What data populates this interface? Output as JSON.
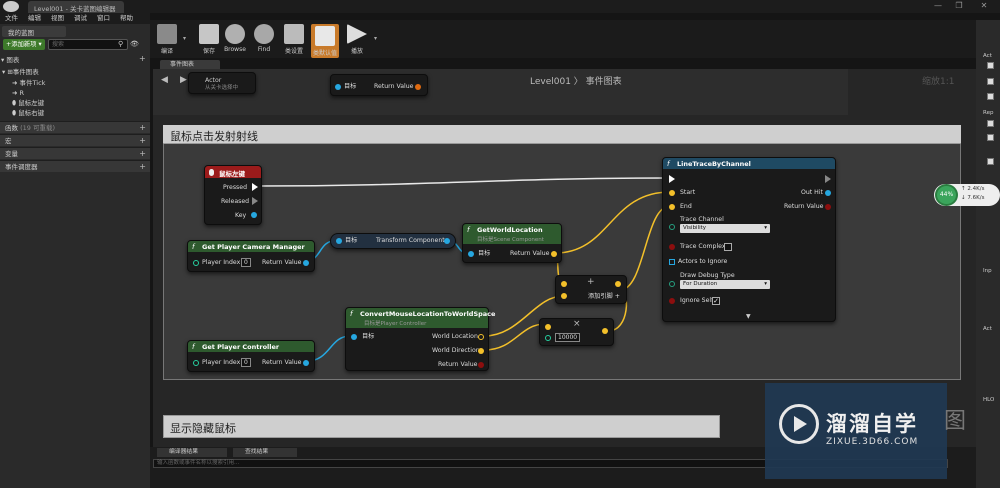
{
  "window": {
    "tab_title": "Level001 - 关卡蓝图编辑器",
    "minimize": "—",
    "restore": "❐",
    "close": "✕"
  },
  "menu": [
    "文件",
    "编辑",
    "视图",
    "调试",
    "窗口",
    "帮助"
  ],
  "left_panel": {
    "tab": "我的蓝图",
    "add_new": "+添加新项 ▾",
    "search_placeholder": "搜索",
    "graphs_header": "图表",
    "event_graph": "事件图表",
    "events": [
      "事件Tick",
      "R",
      "鼠标左键",
      "鼠标右键"
    ],
    "functions_header": "函数",
    "functions_note": "(19 可重载)",
    "macros_header": "宏",
    "variables_header": "变量",
    "dispatchers_header": "事件调度器"
  },
  "toolbar": {
    "buttons": [
      "编译",
      "保存",
      "Browse",
      "Find",
      "类设置",
      "类默认值",
      "播放"
    ]
  },
  "graph": {
    "tab": "事件图表",
    "breadcrumb": "Level001 〉 事件图表",
    "zoom": "缩放1:1",
    "top_node_actor": "Actor",
    "top_node_actor_sub": "从关卡选择中",
    "top_node_target": "目标",
    "top_node_return": "Return Value"
  },
  "comments": {
    "c1": "鼠标点击发射射线",
    "c2": "显示隐藏鼠标"
  },
  "nodes": {
    "mouse_left": {
      "title": "鼠标左键",
      "pins": [
        "Pressed",
        "Released",
        "Key"
      ]
    },
    "camera_mgr": {
      "title": "Get Player Camera Manager",
      "index_label": "Player Index",
      "index_value": "0",
      "return": "Return Value"
    },
    "transform": {
      "target": "目标",
      "output": "Transform Component"
    },
    "world_loc": {
      "title": "GetWorldLocation",
      "sub": "目标是Scene Component",
      "target": "目标",
      "return": "Return Value"
    },
    "controller": {
      "title": "Get Player Controller",
      "index_label": "Player Index",
      "index_value": "0",
      "return": "Return Value"
    },
    "convert": {
      "title": "ConvertMouseLocationToWorldSpace",
      "sub": "目标是Player Controller",
      "target": "目标",
      "out1": "World Location",
      "out2": "World Direction",
      "out3": "Return Value"
    },
    "add": {
      "symbol": "+",
      "label": "添加引脚 +"
    },
    "multiply": {
      "symbol": "×",
      "value": "10000"
    },
    "trace": {
      "title": "LineTraceByChannel",
      "start": "Start",
      "end": "End",
      "trace_channel": "Trace Channel",
      "channel_value": "Visibility",
      "trace_complex": "Trace Complex",
      "actors_ignore": "Actors to Ignore",
      "debug_type": "Draw Debug Type",
      "debug_value": "For Duration",
      "ignore_self": "Ignore Self",
      "out_hit": "Out Hit",
      "return": "Return Value"
    }
  },
  "bottom": {
    "tab1": "编译器结果",
    "tab2": "查找结果",
    "input_placeholder": "输入函数或事件名称以搜索引用..."
  },
  "right_panel": {
    "labels": [
      "Act",
      "Rep",
      "Inp",
      "Act",
      "HLO"
    ]
  },
  "net": {
    "percent": "44%",
    "up": "2.4K/s",
    "down": "7.6K/s"
  },
  "watermark": {
    "brand": "溜溜自学",
    "url": "ZIXUE.3D66.COM",
    "ghost": "图"
  },
  "colors": {
    "event_header": "#9b1b1b",
    "func_header": "#2e5a2e",
    "exec_pin": "#ffffff",
    "vector_pin": "#f3c02a",
    "object_pin": "#26a7e0",
    "bool_pin": "#8c0e0e",
    "accent_toolbar": "#c87a2a"
  }
}
